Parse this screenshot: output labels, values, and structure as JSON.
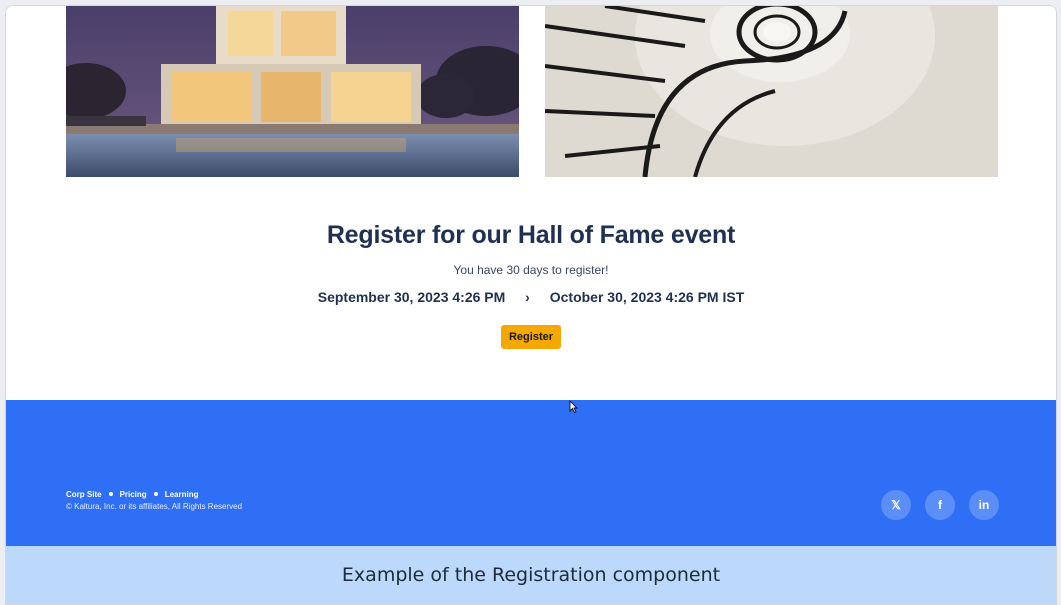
{
  "registration": {
    "title": "Register for our Hall of Fame event",
    "subtitle": "You have 30 days to register!",
    "start_date": "September 30, 2023 4:26 PM",
    "arrow": "›",
    "end_date": "October 30, 2023 4:26 PM IST",
    "button_label": "Register"
  },
  "footer": {
    "links": [
      "Corp Site",
      "Pricing",
      "Learning"
    ],
    "copyright": "© Kaltura, Inc. or its affiliates, All Rights Reserved",
    "social": {
      "x_label": "𝕏",
      "facebook_label": "f",
      "linkedin_label": "in"
    }
  },
  "caption": "Example of the Registration component",
  "colors": {
    "footer_bg": "#2f6ff5",
    "button_bg": "#f5a800",
    "title_color": "#1f3050",
    "caption_bg": "#bcd8fb"
  },
  "icons": [
    "x-icon",
    "facebook-icon",
    "linkedin-icon",
    "mouse-cursor-icon"
  ]
}
